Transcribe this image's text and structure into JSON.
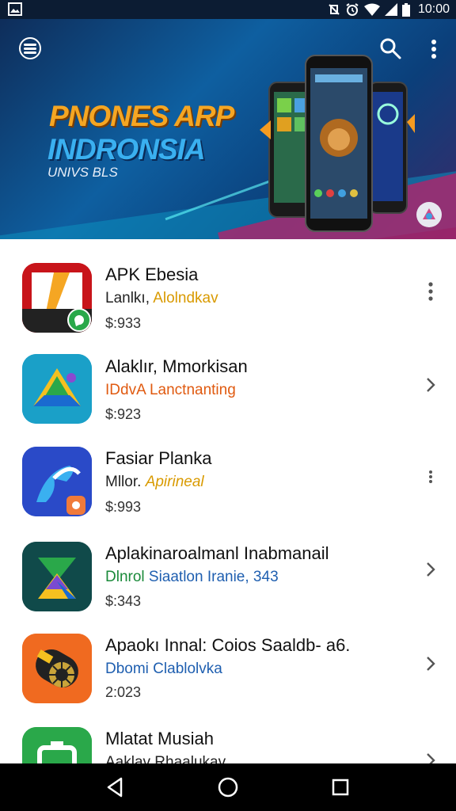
{
  "status_bar": {
    "time": "10:00",
    "icons": [
      "image-icon",
      "vibrate-icon",
      "alarm-icon",
      "wifi-icon",
      "signal-icon",
      "battery-icon"
    ]
  },
  "hero": {
    "title_line1": "PNONES ARP",
    "title_line2": "INDRONSIA",
    "subtitle": "UNIVS BLS",
    "icons": [
      "menu-icon",
      "search-icon",
      "more-vert-icon"
    ]
  },
  "apps": [
    {
      "name": "APK Ebesia",
      "category_prefix": "Lanlkı, ",
      "category_highlight": "Alolndkav",
      "meta": "$:933",
      "action": "more-vert-icon"
    },
    {
      "name": "Alaklır, Mmorkisan",
      "category_prefix": "",
      "category_highlight": "IDdvA Lanctnanting",
      "meta": "$:923",
      "action": "chevron-right-icon"
    },
    {
      "name": "Fasiar Planka",
      "category_prefix": "Mllor. ",
      "category_highlight": "Apirineal",
      "meta": "$:993",
      "action": "more-vert-icon"
    },
    {
      "name": "Aplakinaroalmanl Inabmanail",
      "category_prefix": "Dlnrol ",
      "category_highlight": "Siaatlon Iranie, 343",
      "meta": "$:343",
      "action": "chevron-right-icon"
    },
    {
      "name": "Apaokı Innal: Coios Saaldb- a6.",
      "category_prefix": "",
      "category_highlight": "Dbomi Clablolvka",
      "meta": "2:023",
      "action": "chevron-right-icon"
    },
    {
      "name": "Mlatat Musiah",
      "category_prefix": "",
      "category_highlight": "Aaklav Rhaalukav",
      "meta": "",
      "action": "chevron-right-icon"
    }
  ],
  "colors": {
    "status_bar_bg": "#0c1c33",
    "cat_yellow": "#d99a00",
    "cat_orange": "#e05a10",
    "cat_green": "#1a8a3a",
    "cat_blue": "#1f5fb0"
  },
  "nav": {
    "icons": [
      "back-icon",
      "home-icon",
      "recents-icon"
    ]
  }
}
